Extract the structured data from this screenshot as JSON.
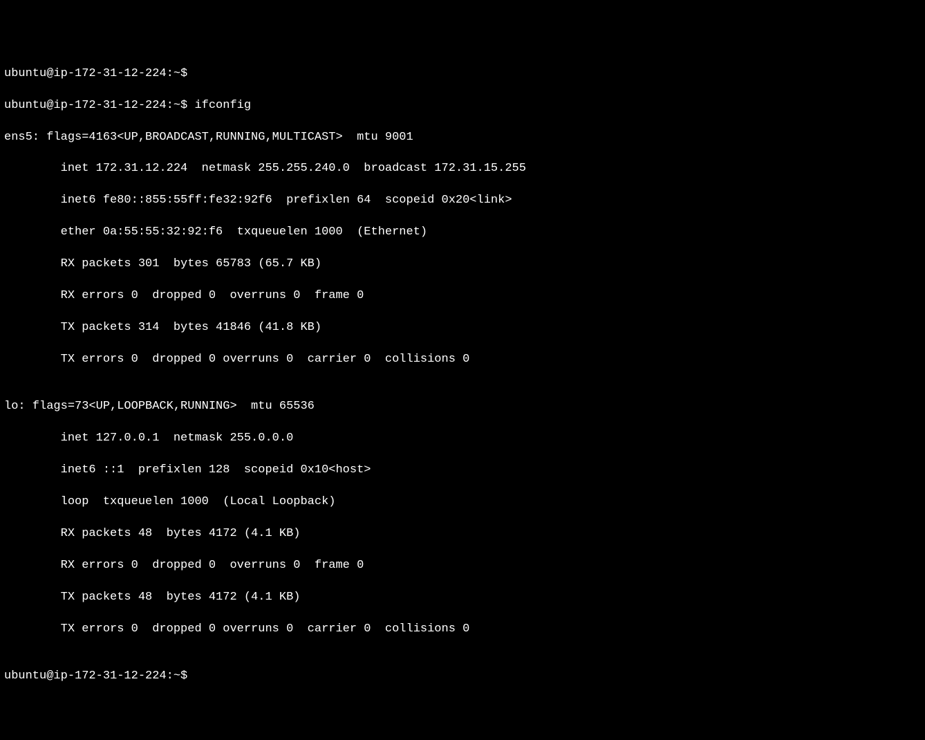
{
  "prompt": "ubuntu@ip-172-31-12-224:~$",
  "command": "ifconfig",
  "interfaces": [
    {
      "name": "ens5",
      "flags_num": "4163",
      "flags_list": "UP,BROADCAST,RUNNING,MULTICAST",
      "mtu": "9001",
      "inet": "172.31.12.224",
      "netmask": "255.255.240.0",
      "broadcast": "172.31.15.255",
      "inet6": "fe80::855:55ff:fe32:92f6",
      "prefixlen": "64",
      "scopeid": "0x20<link>",
      "ether": "0a:55:55:32:92:f6",
      "txqueuelen": "1000",
      "iface_type": "Ethernet",
      "rx_packets": "301",
      "rx_bytes": "65783",
      "rx_bytes_human": "65.7 KB",
      "rx_errors": "0",
      "rx_dropped": "0",
      "rx_overruns": "0",
      "rx_frame": "0",
      "tx_packets": "314",
      "tx_bytes": "41846",
      "tx_bytes_human": "41.8 KB",
      "tx_errors": "0",
      "tx_dropped": "0",
      "tx_overruns": "0",
      "tx_carrier": "0",
      "tx_collisions": "0"
    },
    {
      "name": "lo",
      "flags_num": "73",
      "flags_list": "UP,LOOPBACK,RUNNING",
      "mtu": "65536",
      "inet": "127.0.0.1",
      "netmask": "255.0.0.0",
      "inet6": "::1",
      "prefixlen": "128",
      "scopeid": "0x10<host>",
      "loop_type": "loop",
      "txqueuelen": "1000",
      "iface_type": "Local Loopback",
      "rx_packets": "48",
      "rx_bytes": "4172",
      "rx_bytes_human": "4.1 KB",
      "rx_errors": "0",
      "rx_dropped": "0",
      "rx_overruns": "0",
      "rx_frame": "0",
      "tx_packets": "48",
      "tx_bytes": "4172",
      "tx_bytes_human": "4.1 KB",
      "tx_errors": "0",
      "tx_dropped": "0",
      "tx_overruns": "0",
      "tx_carrier": "0",
      "tx_collisions": "0"
    }
  ],
  "lines": {
    "l0": "ubuntu@ip-172-31-12-224:~$",
    "l1": "ubuntu@ip-172-31-12-224:~$ ifconfig",
    "l2": "ens5: flags=4163<UP,BROADCAST,RUNNING,MULTICAST>  mtu 9001",
    "l3": "        inet 172.31.12.224  netmask 255.255.240.0  broadcast 172.31.15.255",
    "l4": "        inet6 fe80::855:55ff:fe32:92f6  prefixlen 64  scopeid 0x20<link>",
    "l5": "        ether 0a:55:55:32:92:f6  txqueuelen 1000  (Ethernet)",
    "l6": "        RX packets 301  bytes 65783 (65.7 KB)",
    "l7": "        RX errors 0  dropped 0  overruns 0  frame 0",
    "l8": "        TX packets 314  bytes 41846 (41.8 KB)",
    "l9": "        TX errors 0  dropped 0 overruns 0  carrier 0  collisions 0",
    "l10": "",
    "l11": "lo: flags=73<UP,LOOPBACK,RUNNING>  mtu 65536",
    "l12": "        inet 127.0.0.1  netmask 255.0.0.0",
    "l13": "        inet6 ::1  prefixlen 128  scopeid 0x10<host>",
    "l14": "        loop  txqueuelen 1000  (Local Loopback)",
    "l15": "        RX packets 48  bytes 4172 (4.1 KB)",
    "l16": "        RX errors 0  dropped 0  overruns 0  frame 0",
    "l17": "        TX packets 48  bytes 4172 (4.1 KB)",
    "l18": "        TX errors 0  dropped 0 overruns 0  carrier 0  collisions 0",
    "l19": "",
    "l20": "ubuntu@ip-172-31-12-224:~$ "
  }
}
